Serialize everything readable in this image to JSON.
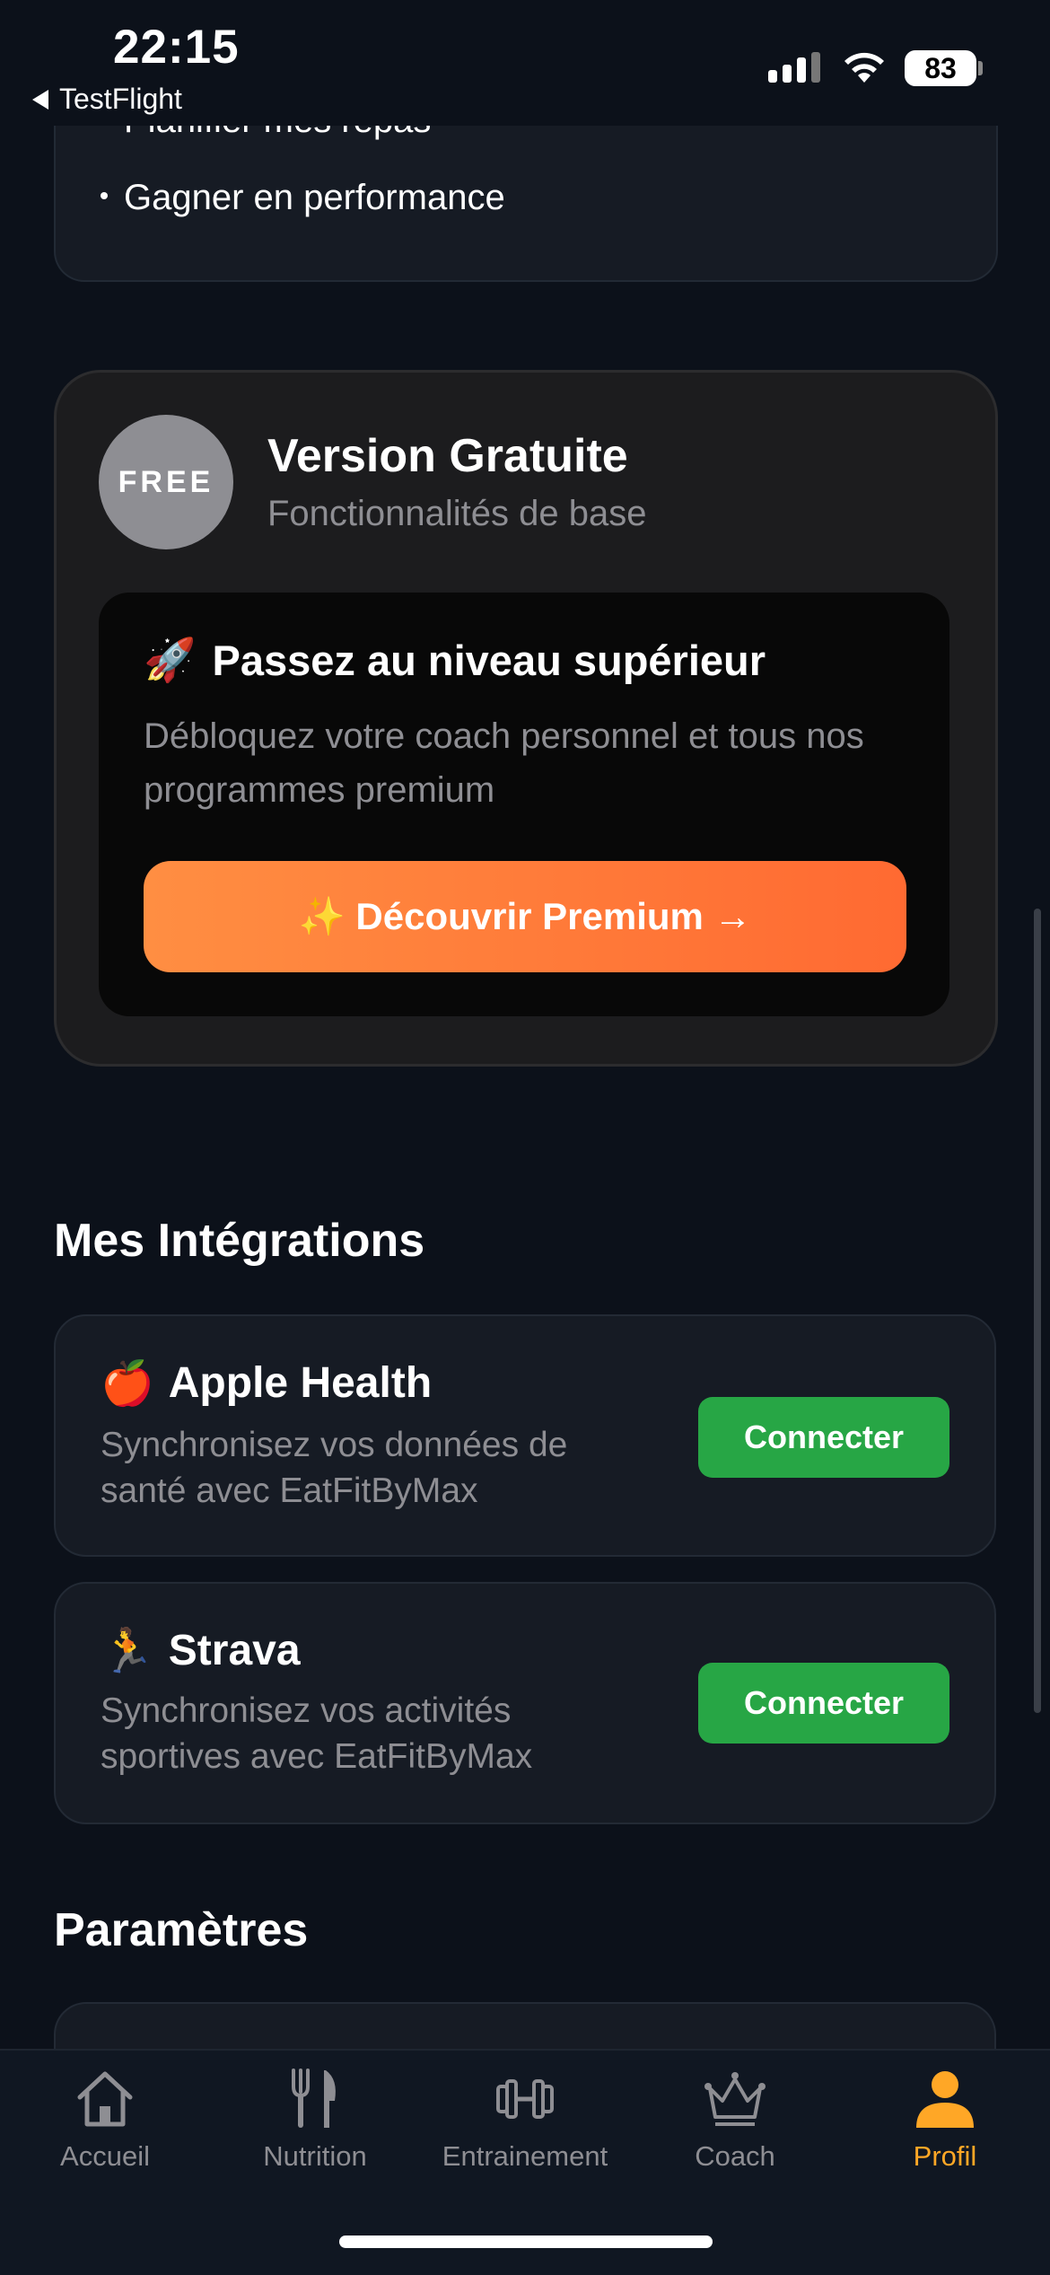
{
  "status_bar": {
    "time": "22:15",
    "back_label": "TestFlight",
    "battery": "83"
  },
  "goals": {
    "items": [
      "Planifier mes repas",
      "Gagner en performance"
    ]
  },
  "plan": {
    "badge": "FREE",
    "title": "Version Gratuite",
    "subtitle": "Fonctionnalités de base",
    "upsell_emoji": "🚀",
    "upsell_title": "Passez au niveau supérieur",
    "upsell_desc": "Débloquez votre coach personnel et tous nos programmes premium",
    "cta_label": "✨ Découvrir Premium →"
  },
  "integrations": {
    "title": "Mes Intégrations",
    "items": [
      {
        "emoji": "🍎",
        "name": "Apple Health",
        "desc": "Synchronisez vos données de santé avec EatFitByMax",
        "button": "Connecter"
      },
      {
        "emoji": "🏃",
        "name": "Strava",
        "desc": "Synchronisez vos activités sportives avec EatFitByMax",
        "button": "Connecter"
      }
    ]
  },
  "settings": {
    "title": "Paramètres"
  },
  "tabbar": {
    "tabs": [
      {
        "label": "Accueil",
        "icon": "home-icon"
      },
      {
        "label": "Nutrition",
        "icon": "fork-knife-icon"
      },
      {
        "label": "Entrainement",
        "icon": "dumbbell-icon"
      },
      {
        "label": "Coach",
        "icon": "crown-icon"
      },
      {
        "label": "Profil",
        "icon": "person-icon",
        "active": true
      }
    ]
  },
  "colors": {
    "background": "#0c111a",
    "accent": "#ffa726",
    "premium_gradient_start": "#ff8e42",
    "premium_gradient_end": "#ff6a32",
    "connect_green": "#27a645"
  }
}
